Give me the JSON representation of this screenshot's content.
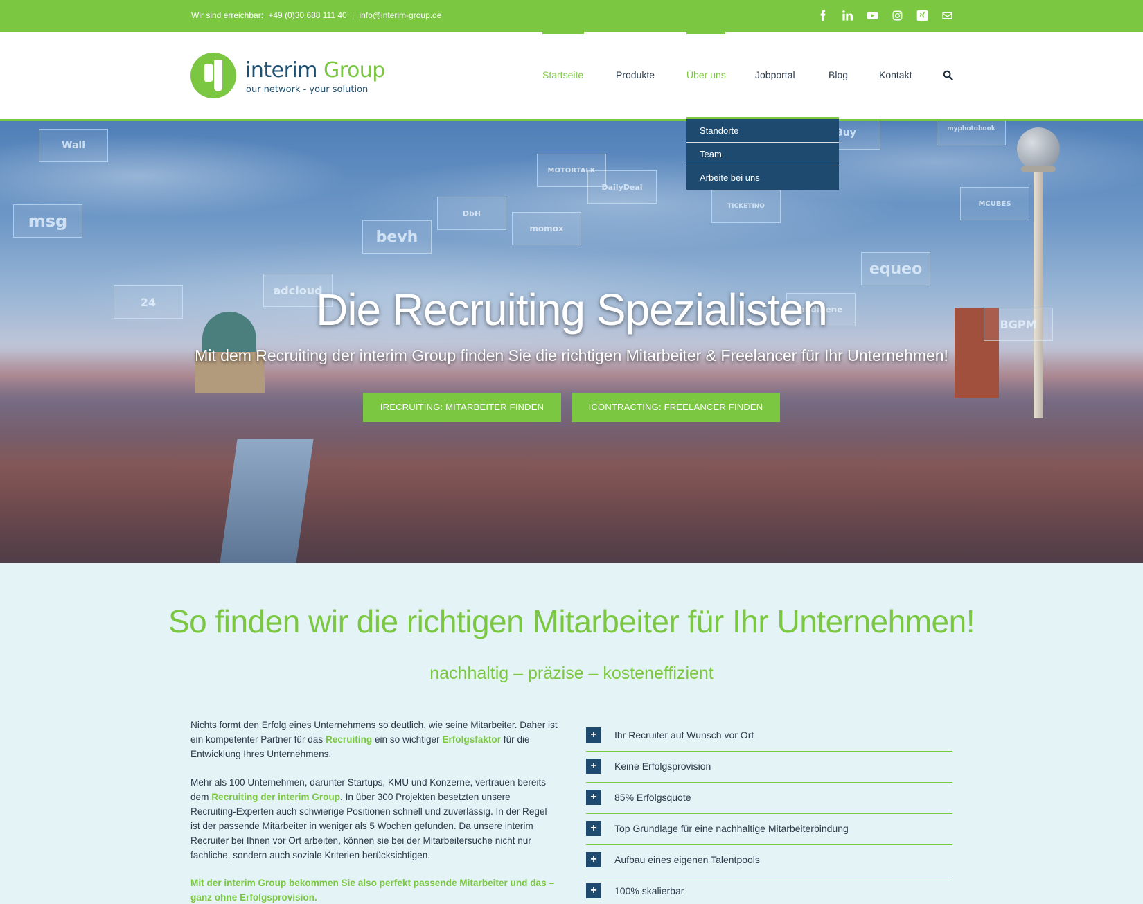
{
  "topbar": {
    "contact_label": "Wir sind erreichbar:",
    "phone": "+49 (0)30 688 111 40",
    "separator": "|",
    "email": "info@interim-group.de",
    "social": [
      "facebook-icon",
      "linkedin-icon",
      "youtube-icon",
      "instagram-icon",
      "xing-icon",
      "mail-icon"
    ]
  },
  "logo": {
    "name_first": "interim",
    "name_second": "Group",
    "tagline": "our network - your solution"
  },
  "nav": {
    "items": [
      "Startseite",
      "Produkte",
      "Über uns",
      "Jobportal",
      "Blog",
      "Kontakt"
    ],
    "active": "Startseite",
    "open_menu": "Über uns"
  },
  "dropdown": {
    "items": [
      "Standorte",
      "Team",
      "Arbeite bei uns"
    ]
  },
  "hero": {
    "title": "Die Recruiting Spezialisten",
    "subtitle": "Mit dem Recruiting der interim Group finden Sie die richtigen Mitarbeiter & Freelancer für Ihr Unternehmen!",
    "cta_recruiting": "IRECRUITING: MITARBEITER FINDEN",
    "cta_contracting": "ICONTRACTING: FREELANCER FINDEN",
    "logos": [
      "Wall",
      "msg",
      "bevh",
      "adcloud",
      "24",
      "DailyDeal",
      "MOTORTALK",
      "momox",
      "DbH",
      "equeo",
      "audibene",
      "BGPM",
      "MCUBES",
      "Buy",
      "myphotobook",
      "TICKETINO"
    ]
  },
  "content": {
    "heading": "So finden wir die richtigen Mitarbeiter für Ihr Unternehmen!",
    "tagline": "nachhaltig – präzise – kosteneffizient",
    "p1_a": "Nichts formt den Erfolg eines Unternehmens so deutlich, wie seine Mitarbeiter. Daher ist ein kompetenter Partner für das ",
    "p1_hl1": "Recruiting",
    "p1_b": " ein so wichtiger ",
    "p1_hl2": "Erfolgsfaktor",
    "p1_c": " für die Entwicklung Ihres Unternehmens.",
    "p2_a": "Mehr als 100 Unternehmen, darunter Startups, KMU und Konzerne, vertrauen bereits dem ",
    "p2_hl": "Recruiting der interim Group",
    "p2_b": ". In über 300 Projekten besetzten unsere Recruiting-Experten auch schwierige Positionen schnell und zuverlässig. In der Regel ist der passende Mitarbeiter in weniger als 5 Wochen gefunden. Da unsere interim Recruiter bei Ihnen vor Ort arbeiten, können sie bei der Mitarbeitersuche nicht nur fachliche, sondern auch soziale Kriterien berücksichtigen.",
    "p3": "Mit der interim Group bekommen Sie also perfekt passende Mitarbeiter und das – ganz ohne Erfolgsprovision.",
    "features": [
      "Ihr Recruiter auf Wunsch vor Ort",
      "Keine Erfolgsprovision",
      "85% Erfolgsquote",
      "Top Grundlage für eine nachhaltige Mitarbeiterbindung",
      "Aufbau eines eigenen Talentpools",
      "100% skalierbar"
    ],
    "plus_symbol": "+"
  },
  "colors": {
    "accent": "#7cc742",
    "navy": "#1d4a6e",
    "background": "#e4f4f6"
  }
}
